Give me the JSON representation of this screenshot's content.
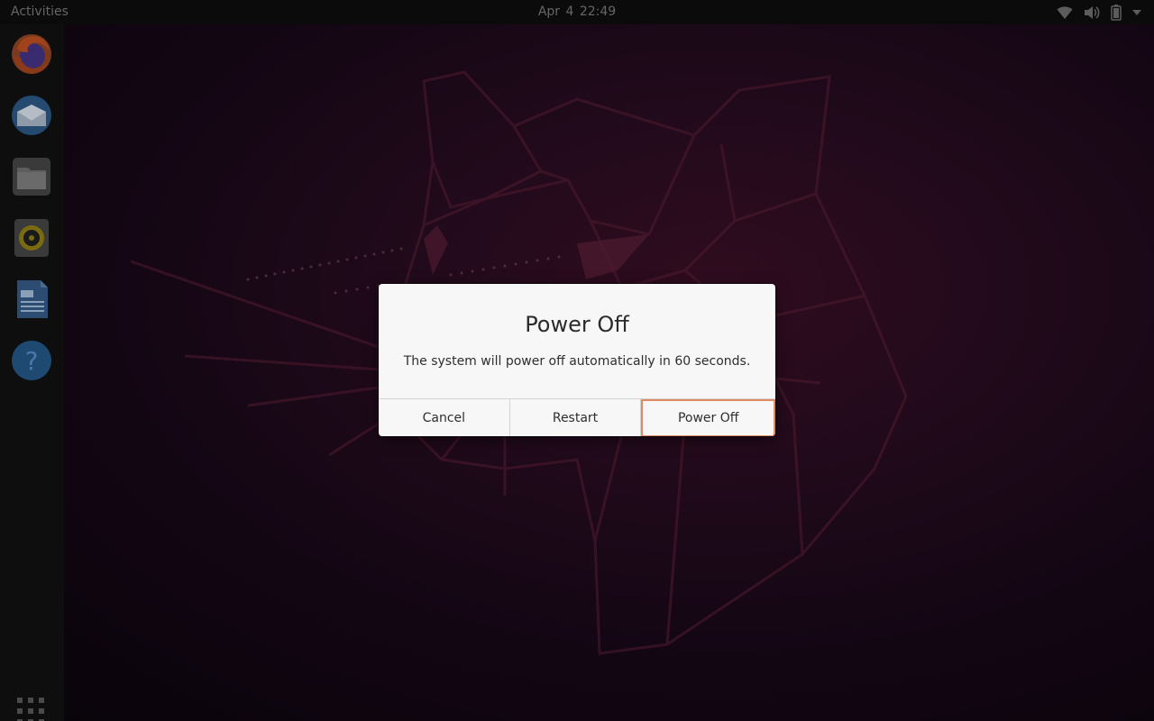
{
  "topbar": {
    "activities_label": "Activities",
    "clock": "Apr 4  22:49",
    "tray_icons": [
      "wifi-icon",
      "volume-icon",
      "battery-icon",
      "system-menu-arrow-icon"
    ]
  },
  "dock": {
    "apps": [
      {
        "name": "Firefox",
        "icon": "firefox-icon"
      },
      {
        "name": "Thunderbird",
        "icon": "thunderbird-icon"
      },
      {
        "name": "Files",
        "icon": "files-icon"
      },
      {
        "name": "Rhythmbox",
        "icon": "rhythmbox-icon"
      },
      {
        "name": "LibreOffice Writer",
        "icon": "writer-icon"
      },
      {
        "name": "Help",
        "icon": "help-icon"
      }
    ],
    "show_apps_icon": "app-grid-icon"
  },
  "dialog": {
    "title": "Power Off",
    "message": "The system will power off automatically in 60 seconds.",
    "buttons": {
      "cancel": "Cancel",
      "restart": "Restart",
      "power_off": "Power Off"
    },
    "focus_color": "#e08a63"
  },
  "colors": {
    "panel": "#0b0b0b",
    "dialog_bg": "#f7f7f7",
    "wallpaper_accent": "#4a1330"
  }
}
